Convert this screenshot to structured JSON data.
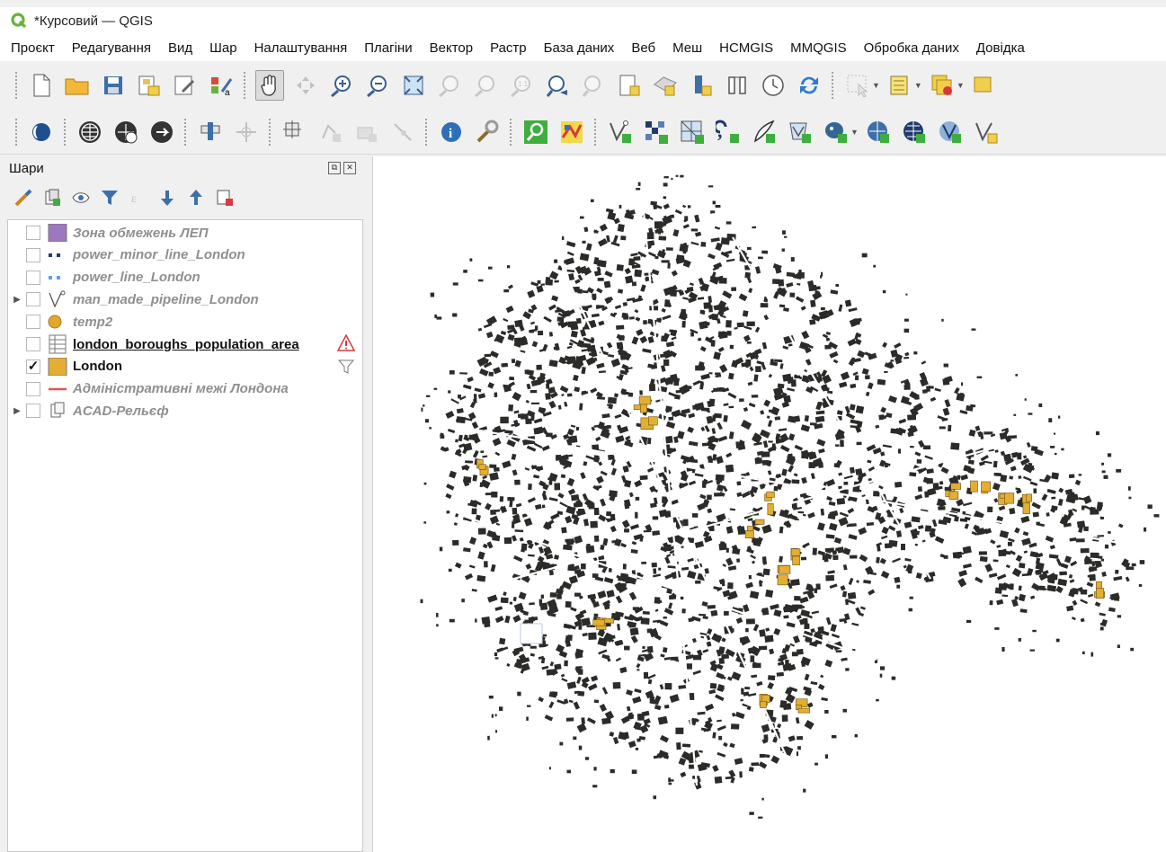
{
  "window": {
    "title": "*Курсовий — QGIS",
    "logo": "qgis-logo"
  },
  "menu": [
    "Проєкт",
    "Редагування",
    "Вид",
    "Шар",
    "Налаштування",
    "Плагіни",
    "Вектор",
    "Растр",
    "База даних",
    "Веб",
    "Меш",
    "HCMGIS",
    "MMQGIS",
    "Обробка даних",
    "Довідка"
  ],
  "layers_panel": {
    "title": "Шари",
    "layers": [
      {
        "name": "Зона обмежень ЛЕП",
        "visible": false,
        "symbol": "polygon-fill",
        "color": "#9d77c0",
        "expandable": false
      },
      {
        "name": "power_minor_line_London",
        "visible": false,
        "symbol": "dashed-line",
        "color": "#1f3a6e",
        "expandable": false
      },
      {
        "name": "power_line_London",
        "visible": false,
        "symbol": "dashed-line",
        "color": "#5aa0e8",
        "expandable": false
      },
      {
        "name": "man_made_pipeline_London",
        "visible": false,
        "symbol": "line-vertex",
        "color": "#555555",
        "expandable": true
      },
      {
        "name": "temp2",
        "visible": false,
        "symbol": "point-circle",
        "color": "#e3a82b",
        "expandable": false
      },
      {
        "name": "london_boroughs_population_area",
        "visible": false,
        "symbol": "table",
        "color": "#777777",
        "expandable": false,
        "warning": true,
        "filter": true
      },
      {
        "name": "London",
        "visible": true,
        "symbol": "polygon-fill",
        "color": "#e3ae33",
        "expandable": false
      },
      {
        "name": "Адміністративні межі Лондона",
        "visible": false,
        "symbol": "solid-line",
        "color": "#e05555",
        "expandable": false
      },
      {
        "name": "ACAD-Рельєф",
        "visible": false,
        "symbol": "group",
        "color": "#666666",
        "expandable": true
      }
    ]
  },
  "toolbar_row1": [
    "new-project-icon",
    "open-project-icon",
    "save-project-icon",
    "print-layout-icon",
    "layout-manager-icon",
    "style-manager-icon",
    "pan-icon",
    "pan-to-selection-icon",
    "zoom-in-icon",
    "zoom-out-icon",
    "zoom-full-icon",
    "zoom-to-selection-icon",
    "zoom-to-layer-icon",
    "zoom-native-icon",
    "zoom-last-icon",
    "zoom-next-icon",
    "new-bookmark-icon",
    "show-bookmarks-icon",
    "map-tips-icon",
    "temporal-controller-icon",
    "refresh-icon",
    "select-feature-icon",
    "attribute-table-icon",
    "deselect-icon",
    "field-calculator-icon"
  ],
  "toolbar_row2": [
    "plugin-icon",
    "globe-icon",
    "globe-download-icon",
    "globe-arrow-icon",
    "label-pin-icon",
    "move-label-icon",
    "digitize-icon",
    "add-feature-icon",
    "vertex-tool-icon",
    "node-tool-icon",
    "identify-icon",
    "processing-toolbox-icon",
    "search-icon",
    "graphic-modeler-icon",
    "add-vector-layer-icon",
    "add-raster-layer-icon",
    "add-mesh-layer-icon",
    "add-delimited-text-icon",
    "add-spatialite-icon",
    "add-virtual-layer-icon",
    "add-postgis-icon",
    "add-wms-icon",
    "add-wfs-icon",
    "add-wcs-icon",
    "new-shapefile-icon"
  ],
  "colors": {
    "buildings": "#2b2b29",
    "highlight": "#e3ae33",
    "canvas": "#ffffff"
  }
}
